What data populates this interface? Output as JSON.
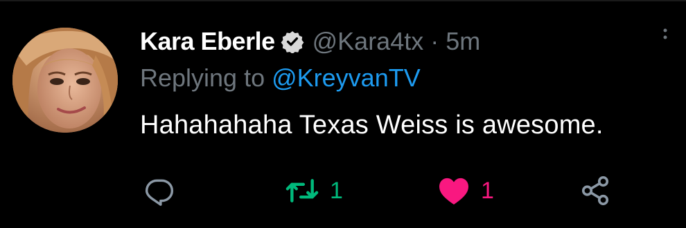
{
  "tweet": {
    "author": {
      "display_name": "Kara Eberle",
      "handle": "@Kara4tx",
      "verified": true,
      "avatar_icon": "avatar-photo"
    },
    "separator": "·",
    "time": "5m",
    "reply_prefix": "Replying to",
    "reply_to": "@KreyvanTV",
    "text": "Hahahahaha Texas Weiss is awesome."
  },
  "actions": {
    "reply": {
      "icon": "reply-icon",
      "count": ""
    },
    "retweet": {
      "icon": "retweet-icon",
      "count": "1",
      "active": true
    },
    "like": {
      "icon": "heart-icon",
      "count": "1",
      "active": true
    },
    "share": {
      "icon": "share-icon"
    }
  },
  "colors": {
    "background": "#000000",
    "text_primary": "#ffffff",
    "text_secondary": "#6e767d",
    "link": "#1d9bf0",
    "retweet_active": "#00ba7c",
    "like_active": "#f91880",
    "icon_default": "#8b98a5"
  }
}
